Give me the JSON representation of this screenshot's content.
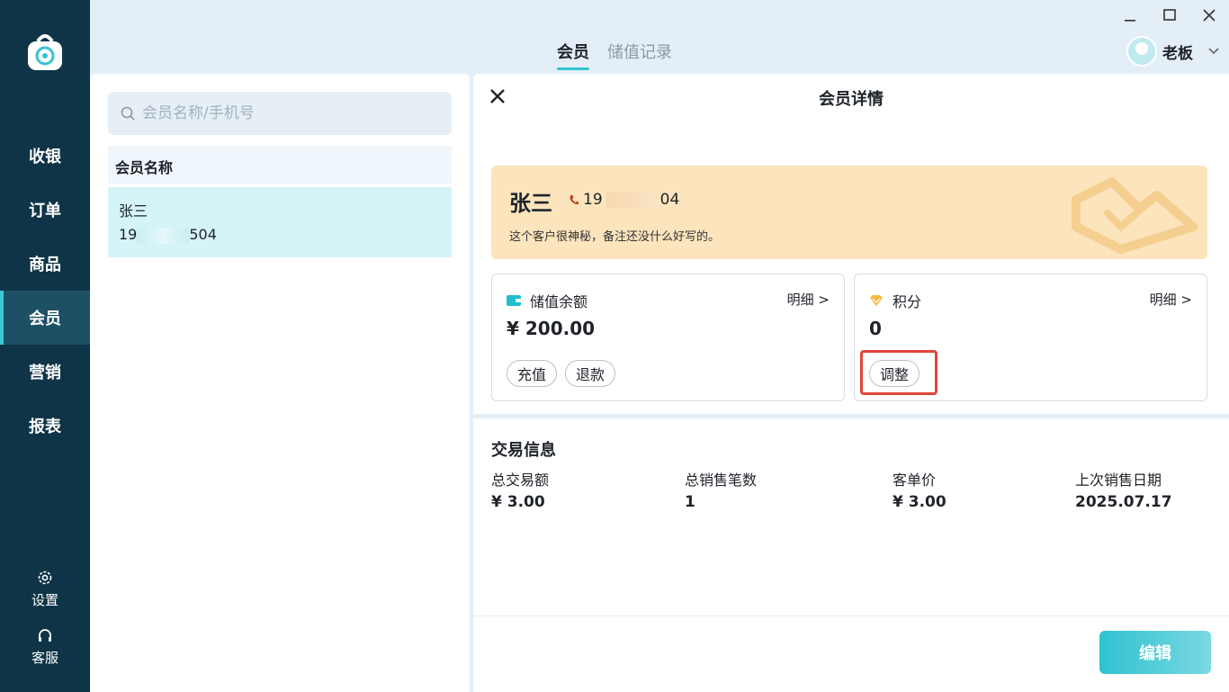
{
  "sidebar": {
    "items": [
      {
        "label": "收银"
      },
      {
        "label": "订单"
      },
      {
        "label": "商品"
      },
      {
        "label": "会员"
      },
      {
        "label": "营销"
      },
      {
        "label": "报表"
      }
    ],
    "active": "会员",
    "settings_label": "设置",
    "service_label": "客服"
  },
  "header": {
    "tabs": [
      {
        "label": "会员",
        "active": true
      },
      {
        "label": "储值记录",
        "active": false
      }
    ],
    "user_name": "老板"
  },
  "left": {
    "search_placeholder": "会员名称/手机号",
    "list_header": "会员名称",
    "members": [
      {
        "name": "张三",
        "phone_prefix": "19",
        "phone_suffix": "504"
      }
    ]
  },
  "detail": {
    "title": "会员详情",
    "card": {
      "name": "张三",
      "phone_prefix": "19",
      "phone_suffix": "04",
      "note": "这个客户很神秘，备注还没什么好写的。"
    },
    "balance": {
      "label": "储值余额",
      "link": "明细 >",
      "value": "¥ 200.00",
      "actions": [
        "充值",
        "退款"
      ]
    },
    "points": {
      "label": "积分",
      "link": "明细 >",
      "value": "0",
      "action": "调整"
    },
    "transactions": {
      "title": "交易信息",
      "stats": [
        {
          "label": "总交易额",
          "value": "¥ 3.00"
        },
        {
          "label": "总销售笔数",
          "value": "1"
        },
        {
          "label": "客单价",
          "value": "¥ 3.00"
        },
        {
          "label": "上次销售日期",
          "value": "2025.07.17"
        }
      ]
    },
    "edit_label": "编辑"
  },
  "colors": {
    "sidebar_bg": "#0f3447",
    "accent": "#35c3d1",
    "card_bg": "#fce4bd",
    "highlight": "#e0443c"
  }
}
